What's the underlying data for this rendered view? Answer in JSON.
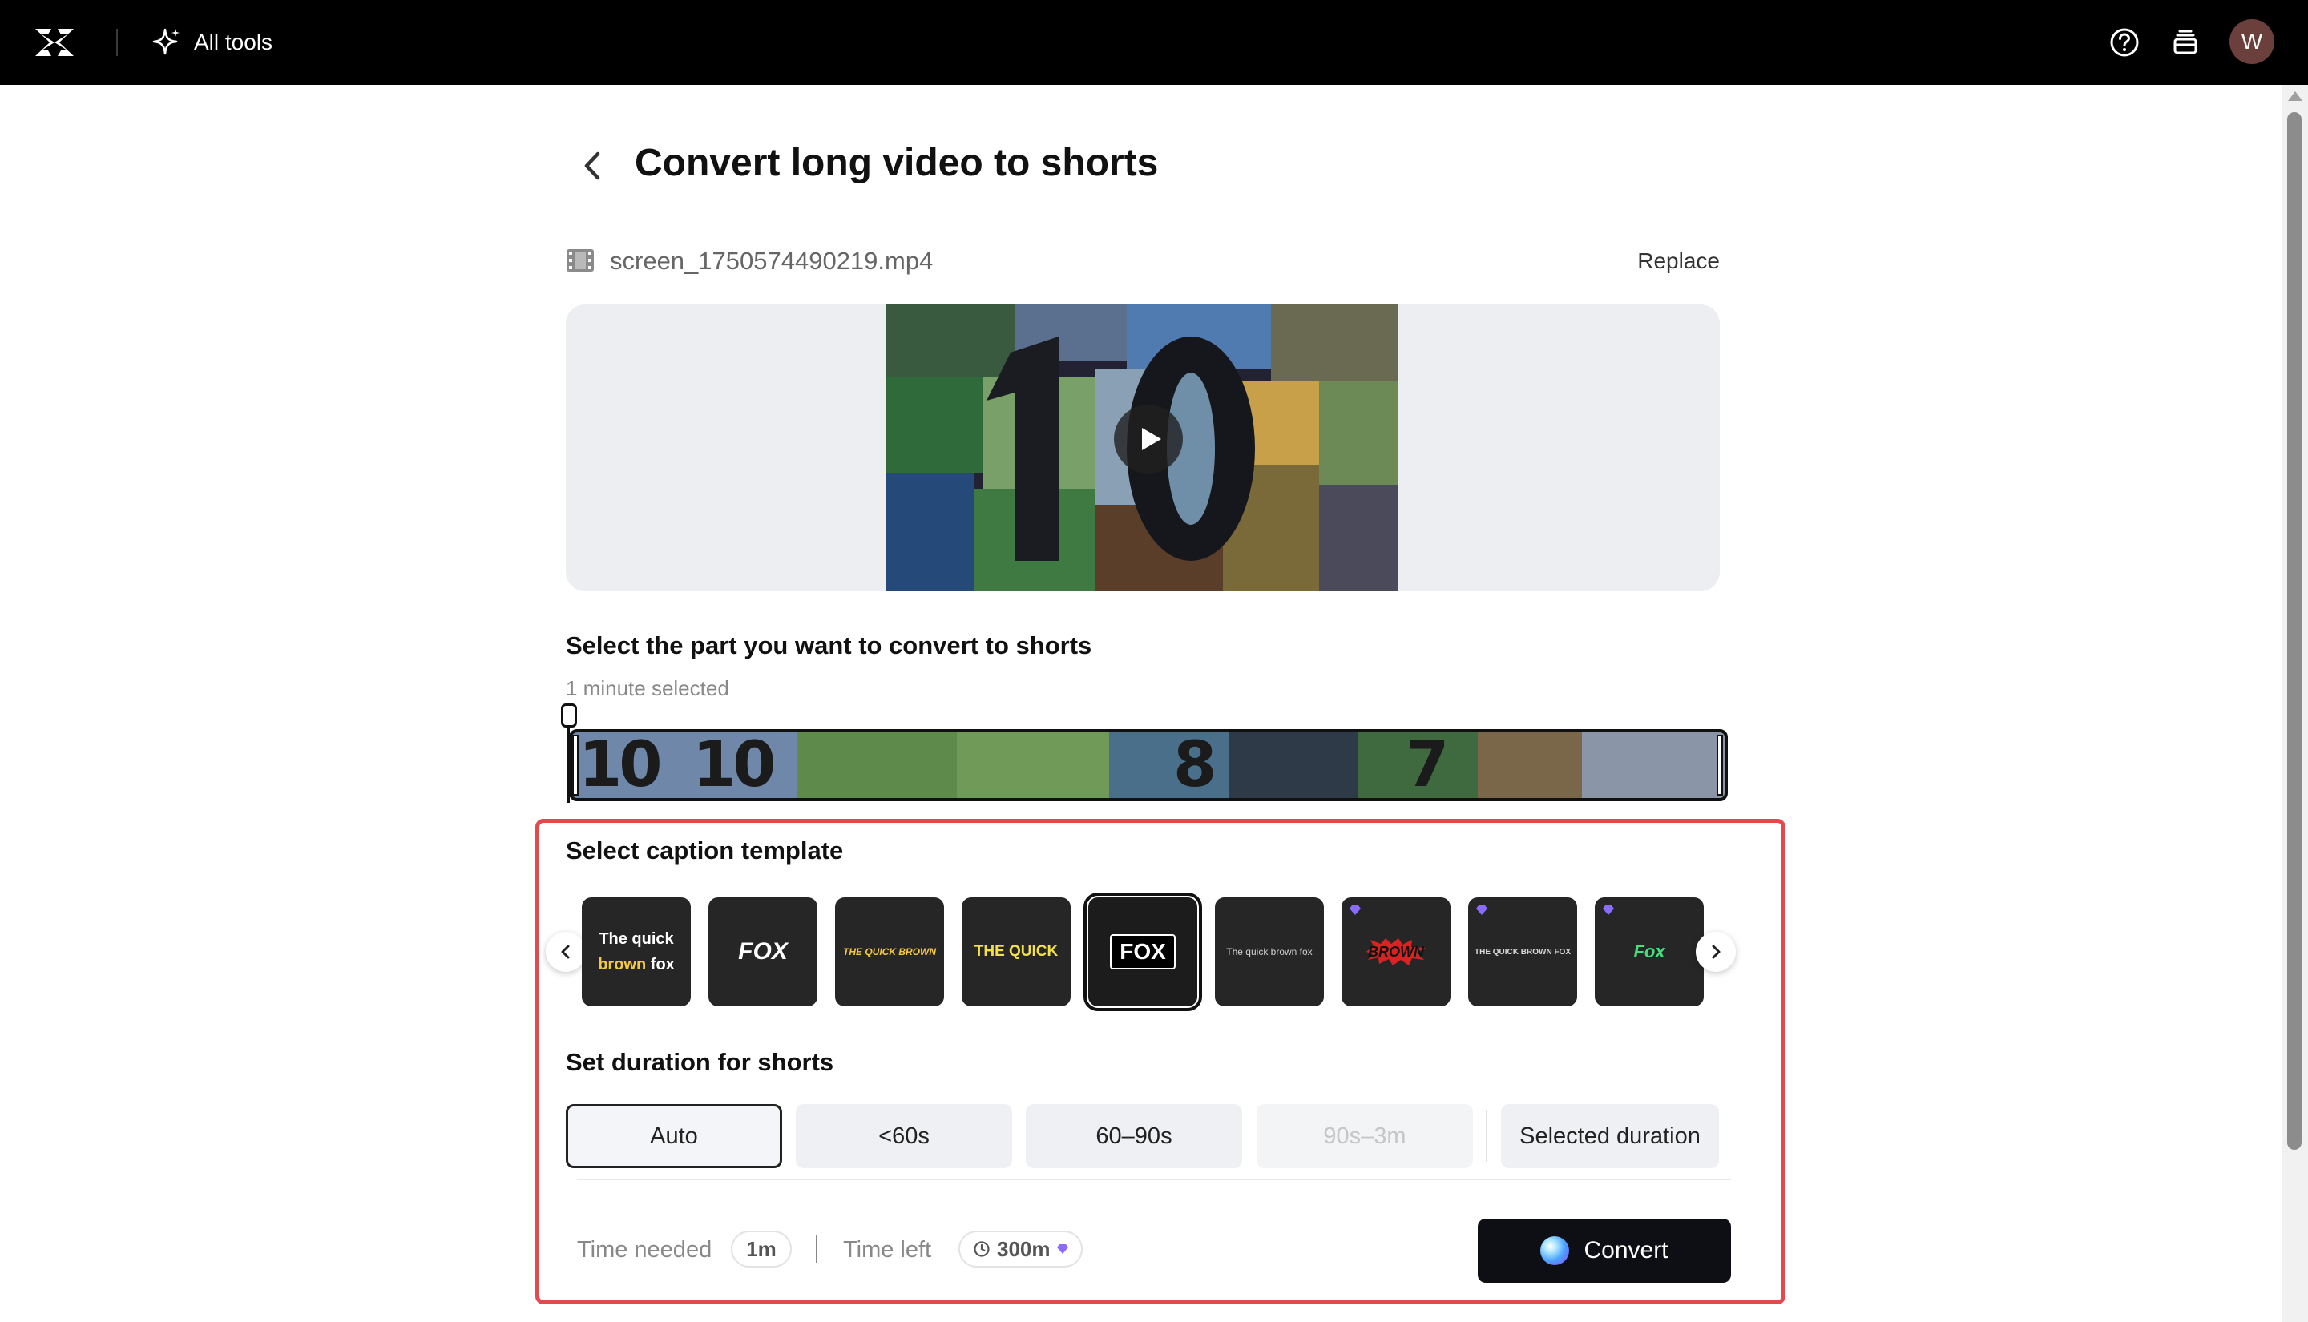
{
  "topbar": {
    "all_tools_label": "All tools",
    "avatar_initial": "W"
  },
  "page": {
    "title": "Convert long video to shorts"
  },
  "file": {
    "name": "screen_1750574490219.mp4",
    "replace_label": "Replace"
  },
  "selection": {
    "heading": "Select the part you want to convert to shorts",
    "selected_note": "1 minute selected",
    "timeline_numbers": [
      "10",
      "10",
      "8",
      "7"
    ]
  },
  "captions": {
    "heading": "Select caption template",
    "templates": [
      {
        "line1": "The quick",
        "line2a": "brown",
        "line2b": "fox",
        "premium": false
      },
      {
        "text": "FOX",
        "premium": false
      },
      {
        "text": "THE QUICK BROWN",
        "premium": false
      },
      {
        "text": "THE QUICK",
        "premium": false
      },
      {
        "text": "FOX",
        "premium": false,
        "selected": true
      },
      {
        "text": "The quick brown fox",
        "premium": false
      },
      {
        "text": "BROWN",
        "premium": true
      },
      {
        "text": "THE QUICK BROWN FOX",
        "premium": true
      },
      {
        "text": "Fox",
        "premium": true
      }
    ]
  },
  "duration": {
    "heading": "Set duration for shorts",
    "options": [
      {
        "label": "Auto",
        "state": "active"
      },
      {
        "label": "<60s",
        "state": "normal"
      },
      {
        "label": "60–90s",
        "state": "normal"
      },
      {
        "label": "90s–3m",
        "state": "disabled"
      },
      {
        "label": "Selected duration",
        "state": "normal"
      }
    ]
  },
  "footer": {
    "time_needed_label": "Time needed",
    "time_needed_value": "1m",
    "time_left_label": "Time left",
    "time_left_value": "300m",
    "convert_label": "Convert"
  },
  "colors": {
    "topbar": "#000000",
    "highlight_border": "#e5484d",
    "convert_button": "#0e0f14",
    "premium_gem": "#8b6cff"
  }
}
